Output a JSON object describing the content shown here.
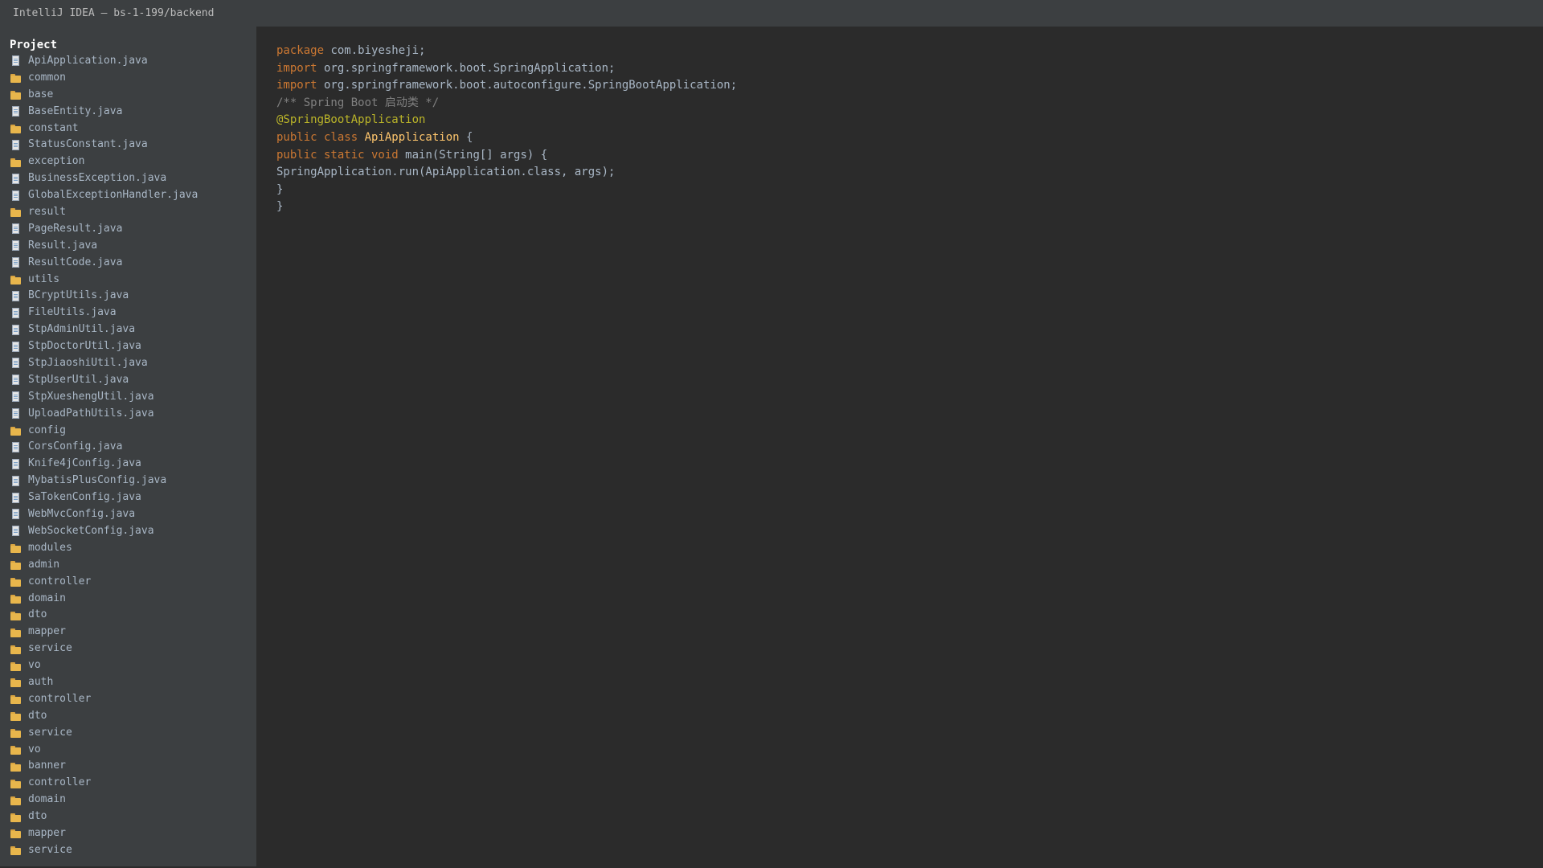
{
  "window": {
    "title": "IntelliJ IDEA — bs-1-199/backend"
  },
  "sidebar": {
    "header": "Project",
    "items": [
      {
        "label": "ApiApplication.java",
        "type": "file"
      },
      {
        "label": "common",
        "type": "folder"
      },
      {
        "label": "base",
        "type": "folder"
      },
      {
        "label": "BaseEntity.java",
        "type": "file"
      },
      {
        "label": "constant",
        "type": "folder"
      },
      {
        "label": "StatusConstant.java",
        "type": "file"
      },
      {
        "label": "exception",
        "type": "folder"
      },
      {
        "label": "BusinessException.java",
        "type": "file"
      },
      {
        "label": "GlobalExceptionHandler.java",
        "type": "file"
      },
      {
        "label": "result",
        "type": "folder"
      },
      {
        "label": "PageResult.java",
        "type": "file"
      },
      {
        "label": "Result.java",
        "type": "file"
      },
      {
        "label": "ResultCode.java",
        "type": "file"
      },
      {
        "label": "utils",
        "type": "folder"
      },
      {
        "label": "BCryptUtils.java",
        "type": "file"
      },
      {
        "label": "FileUtils.java",
        "type": "file"
      },
      {
        "label": "StpAdminUtil.java",
        "type": "file"
      },
      {
        "label": "StpDoctorUtil.java",
        "type": "file"
      },
      {
        "label": "StpJiaoshiUtil.java",
        "type": "file"
      },
      {
        "label": "StpUserUtil.java",
        "type": "file"
      },
      {
        "label": "StpXueshengUtil.java",
        "type": "file"
      },
      {
        "label": "UploadPathUtils.java",
        "type": "file"
      },
      {
        "label": "config",
        "type": "folder"
      },
      {
        "label": "CorsConfig.java",
        "type": "file"
      },
      {
        "label": "Knife4jConfig.java",
        "type": "file"
      },
      {
        "label": "MybatisPlusConfig.java",
        "type": "file"
      },
      {
        "label": "SaTokenConfig.java",
        "type": "file"
      },
      {
        "label": "WebMvcConfig.java",
        "type": "file"
      },
      {
        "label": "WebSocketConfig.java",
        "type": "file"
      },
      {
        "label": "modules",
        "type": "folder"
      },
      {
        "label": "admin",
        "type": "folder"
      },
      {
        "label": "controller",
        "type": "folder"
      },
      {
        "label": "domain",
        "type": "folder"
      },
      {
        "label": "dto",
        "type": "folder"
      },
      {
        "label": "mapper",
        "type": "folder"
      },
      {
        "label": "service",
        "type": "folder"
      },
      {
        "label": "vo",
        "type": "folder"
      },
      {
        "label": "auth",
        "type": "folder"
      },
      {
        "label": "controller",
        "type": "folder"
      },
      {
        "label": "dto",
        "type": "folder"
      },
      {
        "label": "service",
        "type": "folder"
      },
      {
        "label": "vo",
        "type": "folder"
      },
      {
        "label": "banner",
        "type": "folder"
      },
      {
        "label": "controller",
        "type": "folder"
      },
      {
        "label": "domain",
        "type": "folder"
      },
      {
        "label": "dto",
        "type": "folder"
      },
      {
        "label": "mapper",
        "type": "folder"
      },
      {
        "label": "service",
        "type": "folder"
      }
    ]
  },
  "editor": {
    "lines": [
      [
        {
          "t": "package",
          "c": "kw"
        },
        {
          "t": " com.biyesheji;",
          "c": ""
        }
      ],
      [
        {
          "t": "import",
          "c": "kw"
        },
        {
          "t": " org.springframework.boot.SpringApplication;",
          "c": ""
        }
      ],
      [
        {
          "t": "import",
          "c": "kw"
        },
        {
          "t": " org.springframework.boot.autoconfigure.SpringBootApplication;",
          "c": ""
        }
      ],
      [
        {
          "t": "/** Spring Boot 启动类 */",
          "c": "cmt"
        }
      ],
      [
        {
          "t": "@SpringBootApplication",
          "c": "ann"
        }
      ],
      [
        {
          "t": "public class ",
          "c": "kw"
        },
        {
          "t": "ApiApplication",
          "c": "cls"
        },
        {
          "t": " {",
          "c": ""
        }
      ],
      [
        {
          "t": "public static void ",
          "c": "kw"
        },
        {
          "t": "main(String[] args) {",
          "c": ""
        }
      ],
      [
        {
          "t": "SpringApplication.run(ApiApplication.class, args);",
          "c": ""
        }
      ],
      [
        {
          "t": "}",
          "c": ""
        }
      ],
      [
        {
          "t": "}",
          "c": ""
        }
      ]
    ]
  }
}
